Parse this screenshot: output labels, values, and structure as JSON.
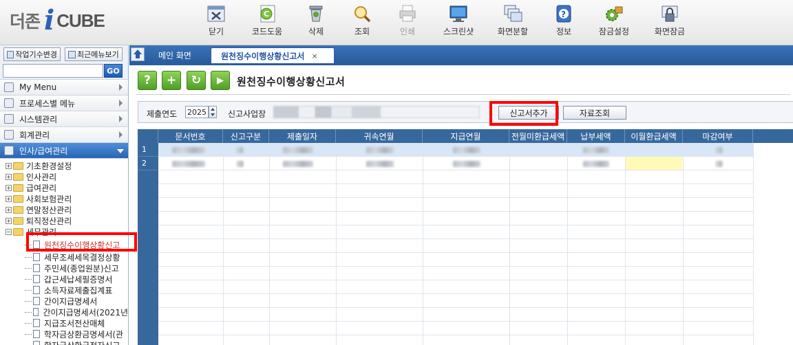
{
  "app": {
    "logo_korean": "더존",
    "logo_i": "i",
    "logo_cube": "CUBE"
  },
  "toolbar": [
    {
      "name": "close",
      "label": "닫기",
      "icon": "close-window-icon",
      "enabled": true
    },
    {
      "name": "code-help",
      "label": "코드도움",
      "icon": "code-help-icon",
      "enabled": true
    },
    {
      "name": "delete",
      "label": "삭제",
      "icon": "trash-icon",
      "enabled": true
    },
    {
      "name": "search",
      "label": "조회",
      "icon": "magnifier-icon",
      "enabled": true
    },
    {
      "name": "print",
      "label": "인쇄",
      "icon": "printer-icon",
      "enabled": false
    },
    {
      "name": "screenshot",
      "label": "스크린샷",
      "icon": "monitor-icon",
      "enabled": true
    },
    {
      "name": "split",
      "label": "화면분할",
      "icon": "split-windows-icon",
      "enabled": true
    },
    {
      "name": "info",
      "label": "정보",
      "icon": "question-icon",
      "enabled": true
    },
    {
      "name": "lock-settings",
      "label": "잠금설정",
      "icon": "gear-lock-icon",
      "enabled": true
    },
    {
      "name": "screen-lock",
      "label": "화면잠금",
      "icon": "padlock-icon",
      "enabled": true
    }
  ],
  "left": {
    "change_company_btn": "작업기수변경",
    "recent_menu_btn": "최근메뉴보기",
    "search_placeholder": "",
    "go_label": "GO",
    "categories": [
      {
        "label": "My Menu",
        "icon": "person-icon"
      },
      {
        "label": "프로세스별 메뉴",
        "icon": "process-icon"
      },
      {
        "label": "시스템관리",
        "icon": "system-icon"
      },
      {
        "label": "회계관리",
        "icon": "accounting-icon"
      },
      {
        "label": "인사/급여관리",
        "icon": "hr-icon",
        "active": true
      }
    ],
    "tree_folders": [
      "기초환경설정",
      "인사관리",
      "급여관리",
      "사회보험관리",
      "연말정산관리",
      "퇴직정산관리",
      "세무관리"
    ],
    "tree_leaves": [
      "원천징수이행상황신고",
      "세무조세세목결정상황",
      "주민세(종업원분)신고",
      "갑근세납세필증명서",
      "소득자료제출집계표",
      "간이지급명세서",
      "간이지급명세서(2021년",
      "지급조서전산매체",
      "학자금상환금명세서(관",
      "학자금상환금전자신고"
    ],
    "selected_leaf_index": 0
  },
  "tabs": {
    "main_label": "메인 화면",
    "active_label": "원천징수이행상황신고서",
    "close_glyph": "×"
  },
  "content": {
    "page_title": "원천징수이행상황신고서",
    "action_buttons": [
      {
        "label": "?",
        "icon": "help-icon"
      },
      {
        "label": "+",
        "icon": "add-icon"
      },
      {
        "label": "↻",
        "icon": "refresh-icon"
      },
      {
        "label": "▶",
        "icon": "run-icon"
      }
    ],
    "filters": {
      "year_label": "제출연도",
      "year_value": "2025",
      "biz_label": "신고사업장",
      "add_report_btn": "신고서추가",
      "data_query_btn": "자료조회"
    }
  },
  "grid": {
    "columns": [
      "문서번호",
      "신고구분",
      "제출일자",
      "귀속연월",
      "지급연월",
      "전월미환급세액",
      "납부세액",
      "이월환급세액",
      "마감여부"
    ],
    "row_numbers": [
      "1",
      "2"
    ]
  },
  "colors": {
    "accent": "#2a5c9e",
    "grid_header": "#37689d",
    "highlight": "#ff0000",
    "selected_row": "#d9e6f7",
    "yellow_cell": "#fffbb7"
  }
}
